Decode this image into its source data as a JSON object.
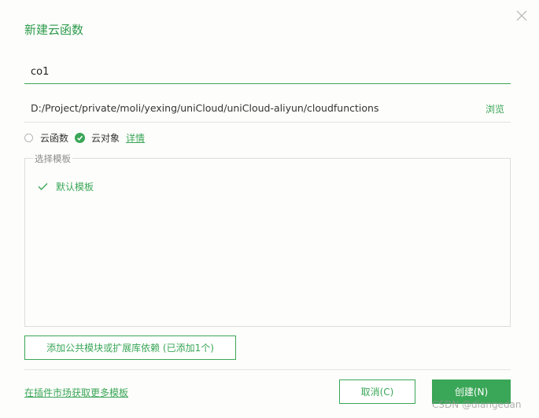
{
  "dialog": {
    "title": "新建云函数",
    "close_icon": "close-icon"
  },
  "name_input": {
    "value": "co1",
    "placeholder": ""
  },
  "path": {
    "text": "D:/Project/private/moli/yexing/uniCloud/uniCloud-aliyun/cloudfunctions",
    "browse_label": "浏览"
  },
  "type_options": {
    "options": [
      {
        "label": "云函数",
        "selected": false
      },
      {
        "label": "云对象",
        "selected": true
      }
    ],
    "detail_link": "详情"
  },
  "templates": {
    "legend": "选择模板",
    "items": [
      {
        "label": "默认模板",
        "selected": true,
        "icon": "checkmark-icon"
      }
    ]
  },
  "dependencies": {
    "button_label": "添加公共模块或扩展库依赖 (已添加1个)"
  },
  "footer": {
    "market_link": "在插件市场获取更多模板",
    "cancel_label": "取消(C)",
    "create_label": "创建(N)"
  },
  "watermark": "CSDN @diangedan",
  "colors": {
    "accent": "#3aa657",
    "title": "#2c9a4b",
    "background": "#fdfdfb"
  }
}
